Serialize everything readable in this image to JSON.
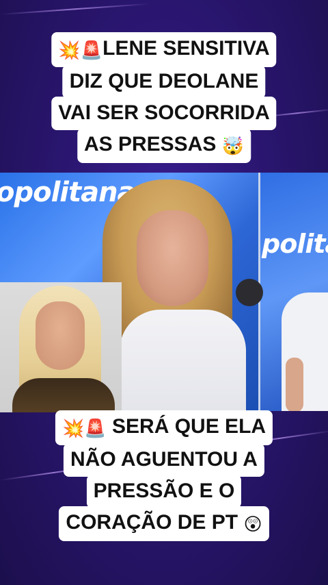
{
  "top_caption": {
    "emoji_1": "💥",
    "emoji_2": "🚨",
    "line_1": "LENE SENSITIVA",
    "line_2": "DIZ QUE DEOLANE",
    "line_3": "VAI SER SOCORRIDA",
    "line_4": "AS PRESSAS",
    "emoji_end": "🤯"
  },
  "photo": {
    "brand_left": "opolitana",
    "brand_right": "politan"
  },
  "bottom_caption": {
    "emoji_1": "💥",
    "emoji_2": "🚨",
    "line_1": "SERÁ QUE ELA",
    "line_2": "NÃO AGUENTOU A",
    "line_3": "PRESSÃO E O",
    "line_4": "CORAÇÃO DE PT",
    "emoji_end": "😲"
  }
}
